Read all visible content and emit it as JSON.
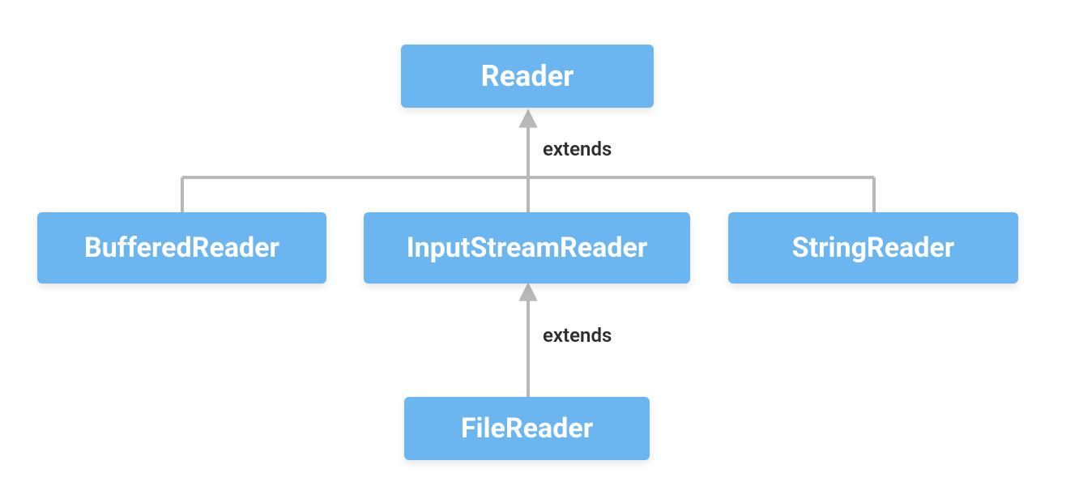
{
  "diagram": {
    "nodes": {
      "reader": "Reader",
      "bufferedReader": "BufferedReader",
      "inputStreamReader": "InputStreamReader",
      "stringReader": "StringReader",
      "fileReader": "FileReader"
    },
    "edges": {
      "midToReader": "extends",
      "fileToInputStream": "extends"
    },
    "colors": {
      "nodeFill": "#6bb6f0",
      "nodeText": "#ffffff",
      "connector": "#b8b8b8",
      "labelText": "#2e2e2e"
    },
    "hierarchy": {
      "Reader": [
        "BufferedReader",
        "InputStreamReader",
        "StringReader"
      ],
      "InputStreamReader": [
        "FileReader"
      ]
    }
  }
}
